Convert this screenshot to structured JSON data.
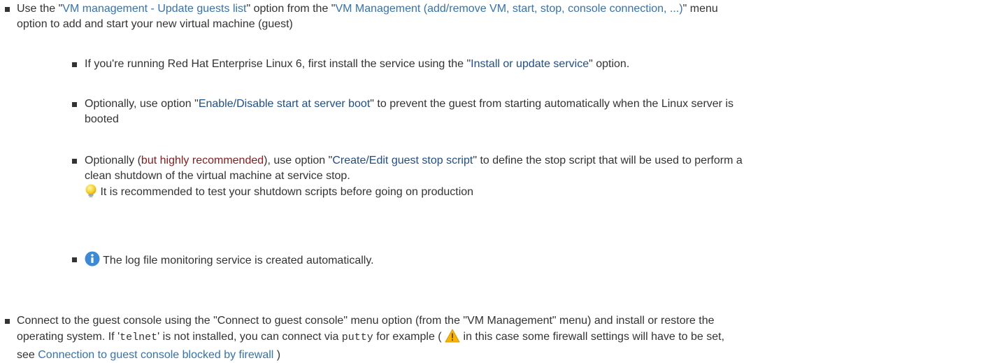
{
  "items": [
    {
      "pre": "Use the \"",
      "link1": "VM management - Update guests list",
      "mid": "\" option from the \"",
      "link2": "VM Management (add/remove VM, start, stop, console connection, ...)",
      "post_line1": "\" menu",
      "line2": "option to add and start your new virtual machine (guest)"
    }
  ],
  "sub_items": {
    "rhel": {
      "pre": "If you're running Red Hat Enterprise Linux 6, first install the service using the \"",
      "link": "Install or update service",
      "post": "\" option."
    },
    "boot": {
      "pre": "Optionally, use option \"",
      "link": "Enable/Disable start at server boot",
      "post": "\" to prevent the guest from starting automatically when the Linux server is",
      "line2": "booted"
    },
    "stop_script": {
      "pre": "Optionally (",
      "highlight": "but highly recommended",
      "mid": "), use option \"",
      "link": "Create/Edit guest stop script",
      "post": "\" to define the stop script that will be used to perform a",
      "line2": "clean shutdown of the virtual machine at service stop.",
      "tip": "It is recommended to test your shutdown scripts before going on production"
    },
    "log": {
      "text": "The log file monitoring service is created automatically."
    }
  },
  "console": {
    "line1": "Connect to the guest console using the \"Connect to guest console\" menu option (from the \"VM Management\" menu) and install or restore the",
    "pre2": "operating system. If '",
    "code1": "telnet",
    "mid2": "' is not installed, you can connect via ",
    "code2": "putty",
    "post2a": " for example ( ",
    "post2b": " in this case some firewall settings will have to be set,",
    "pre3": "see ",
    "link": "Connection to guest console blocked by firewall",
    "post3": " )"
  },
  "colors": {
    "link": "#3572b0",
    "link_dark": "#1f4d8c",
    "highlight": "#8b1a1a",
    "text": "#333333"
  },
  "icons": [
    "lightbulb-icon",
    "info-icon",
    "warning-icon"
  ]
}
